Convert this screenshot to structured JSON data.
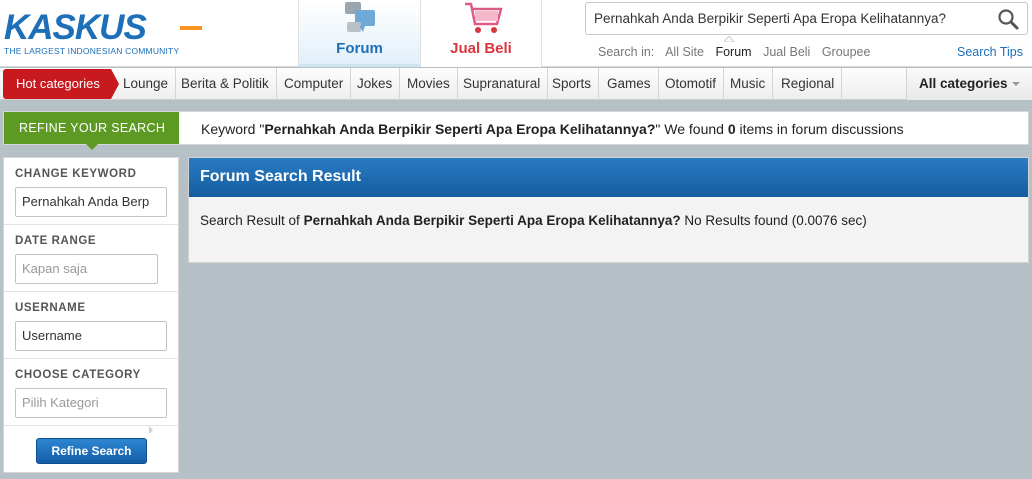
{
  "header": {
    "logo_text": "KASKUS",
    "logo_tagline": "THE LARGEST INDONESIAN COMMUNITY",
    "tabs": [
      {
        "label": "Forum",
        "icon": "forum-icon"
      },
      {
        "label": "Jual Beli",
        "icon": "shopping-cart-icon"
      }
    ],
    "search": {
      "value": "Pernahkah Anda Berpikir Seperti Apa Eropa Kelihatannya?",
      "icon": "search-icon",
      "scope_label": "Search in:",
      "scopes": [
        "All Site",
        "Forum",
        "Jual Beli",
        "Groupee"
      ],
      "active_scope": "Forum",
      "tips": "Search Tips"
    }
  },
  "nav": {
    "hot": "Hot categories",
    "items": [
      "Lounge",
      "Berita & Politik",
      "Computer",
      "Jokes",
      "Movies",
      "Supranatural",
      "Sports",
      "Games",
      "Otomotif",
      "Music",
      "Regional"
    ],
    "all": "All categories"
  },
  "refine": {
    "tab_label": "REFINE YOUR SEARCH",
    "msg_prefix": "Keyword \"",
    "keyword": "Pernahkah Anda Berpikir Seperti Apa Eropa Kelihatannya?",
    "msg_mid": "\" We found ",
    "count": "0",
    "msg_suffix": " items in forum discussions"
  },
  "sidebar": {
    "keyword_title": "CHANGE KEYWORD",
    "keyword_value": "Pernahkah Anda Berp",
    "date_title": "DATE RANGE",
    "date_placeholder": "Kapan saja",
    "username_title": "USERNAME",
    "username_value": "Username",
    "category_title": "CHOOSE CATEGORY",
    "category_placeholder": "Pilih Kategori",
    "button": "Refine Search"
  },
  "result": {
    "title": "Forum Search Result",
    "prefix": "Search Result of ",
    "keyword": "Pernahkah Anda Berpikir Seperti Apa Eropa Kelihatannya?",
    "suffix": " No Results found (0.0076 sec)"
  },
  "colors": {
    "brand_blue": "#1c6fb8",
    "hot_red": "#c8191e",
    "refine_green": "#5d9a23",
    "page_bg": "#b5c0c7"
  }
}
